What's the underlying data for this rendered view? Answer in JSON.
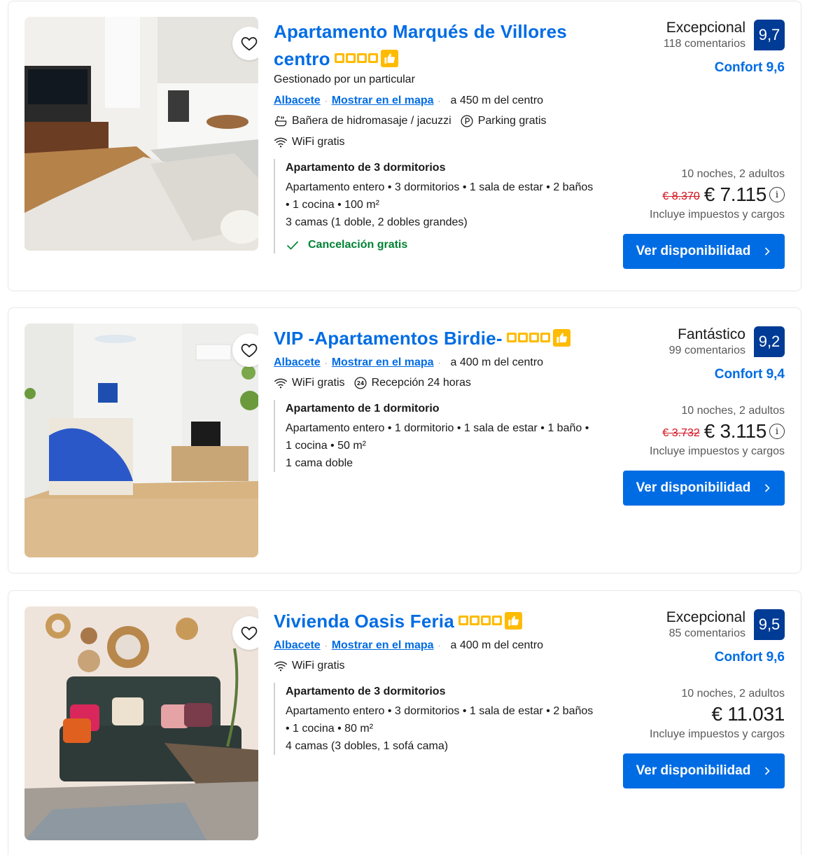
{
  "listings": [
    {
      "title": "Apartamento Marqués de Villores centro",
      "managed_by": "Gestionado por un particular",
      "city": "Albacete",
      "map_link": "Mostrar en el mapa",
      "distance": "a 450 m del centro",
      "facilities": [
        "Bañera de hidromasaje / jacuzzi",
        "Parking gratis",
        "WiFi gratis"
      ],
      "facility_icons": [
        "jacuzzi-icon",
        "parking-icon",
        "wifi-icon"
      ],
      "room_title": "Apartamento de 3 dormitorios",
      "room_desc": "Apartamento entero • 3 dormitorios • 1 sala de estar • 2 baños • 1 cocina • 100 m²",
      "beds": "3 camas (1 doble, 2 dobles grandes)",
      "cancellation": "Cancelación gratis",
      "review_word": "Excepcional",
      "review_count": "118 comentarios",
      "score": "9,7",
      "comfort": "Confort 9,6",
      "nights": "10 noches, 2 adultos",
      "old_price": "€ 8.370",
      "price": "€ 7.115",
      "taxes": "Incluye impuestos y cargos",
      "button": "Ver disponibilidad",
      "star_count": 4
    },
    {
      "title": "VIP -Apartamentos Birdie-",
      "city": "Albacete",
      "map_link": "Mostrar en el mapa",
      "distance": "a 400 m del centro",
      "facilities": [
        "WiFi gratis",
        "Recepción 24 horas"
      ],
      "facility_icons": [
        "wifi-icon",
        "reception-24h-icon"
      ],
      "room_title": "Apartamento de 1 dormitorio",
      "room_desc": "Apartamento entero • 1 dormitorio • 1 sala de estar • 1 baño • 1 cocina • 50 m²",
      "beds": "1 cama doble",
      "review_word": "Fantástico",
      "review_count": "99 comentarios",
      "score": "9,2",
      "comfort": "Confort 9,4",
      "nights": "10 noches, 2 adultos",
      "old_price": "€ 3.732",
      "price": "€ 3.115",
      "taxes": "Incluye impuestos y cargos",
      "button": "Ver disponibilidad",
      "star_count": 4
    },
    {
      "title": "Vivienda Oasis Feria",
      "city": "Albacete",
      "map_link": "Mostrar en el mapa",
      "distance": "a 400 m del centro",
      "facilities": [
        "WiFi gratis"
      ],
      "facility_icons": [
        "wifi-icon"
      ],
      "room_title": "Apartamento de 3 dormitorios",
      "room_desc": "Apartamento entero • 3 dormitorios • 1 sala de estar • 2 baños • 1 cocina • 80 m²",
      "beds": "4 camas (3 dobles, 1 sofá cama)",
      "review_word": "Excepcional",
      "review_count": "85 comentarios",
      "score": "9,5",
      "comfort": "Confort 9,6",
      "nights": "10 noches, 2 adultos",
      "price": "€ 11.031",
      "taxes": "Incluye impuestos y cargos",
      "button": "Ver disponibilidad",
      "star_count": 4
    }
  ],
  "colors": {
    "link_blue": "#006ce4",
    "score_navy": "#003b95",
    "star_yellow": "#febb02",
    "strike_red": "#d4111e",
    "success_green": "#008234"
  }
}
